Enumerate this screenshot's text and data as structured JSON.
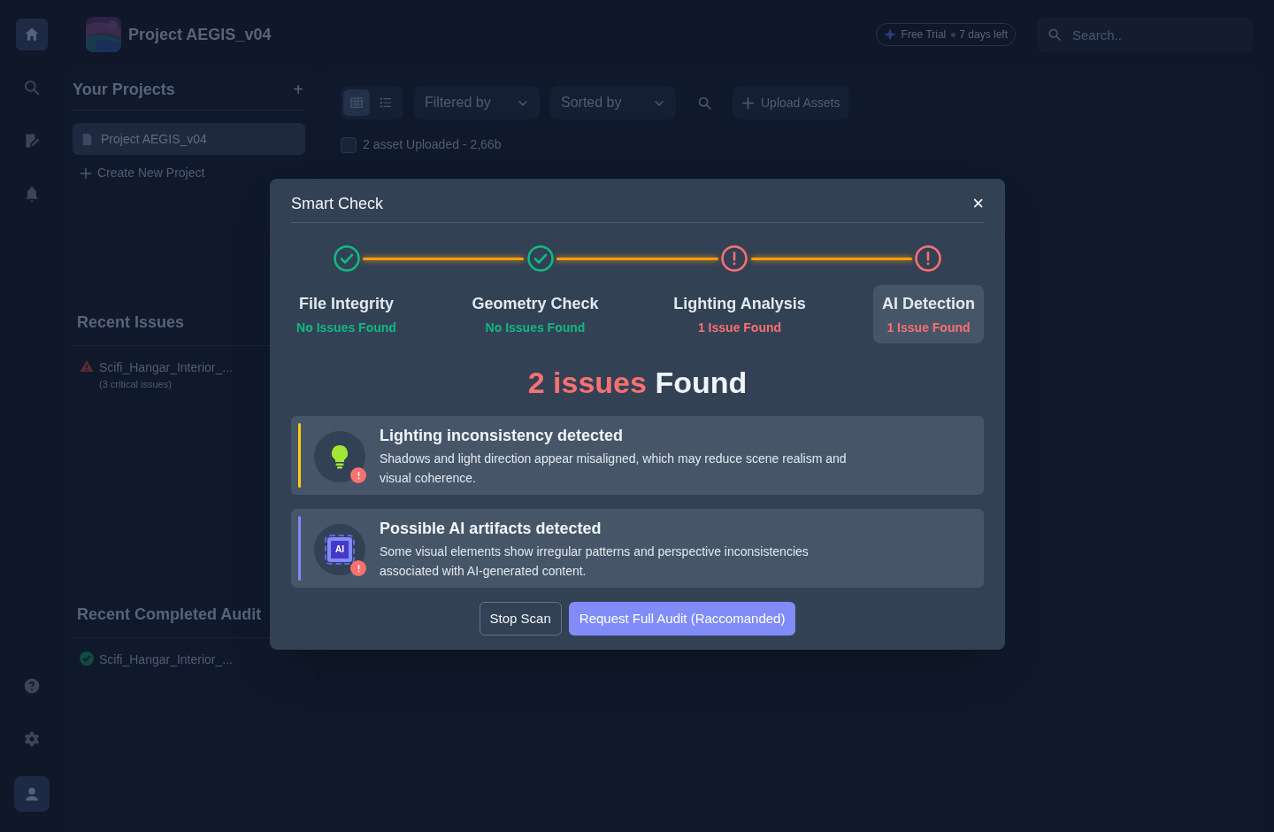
{
  "nav_rail": {
    "top": [
      {
        "kind": "home",
        "selected": true
      },
      {
        "kind": "search",
        "selected": false
      },
      {
        "kind": "report",
        "selected": false
      },
      {
        "kind": "bell",
        "selected": false
      }
    ],
    "bottom": [
      {
        "kind": "help",
        "selected": false
      },
      {
        "kind": "settings",
        "selected": false
      },
      {
        "kind": "user",
        "selected": true
      }
    ]
  },
  "header": {
    "project_title": "Project AEGIS_v04",
    "trial_badge": {
      "label": "Free Trial",
      "days": "7 days left"
    },
    "search": {
      "placeholder": "Search.."
    }
  },
  "projects_panel": {
    "title": "Your Projects",
    "add": "+",
    "items": [
      {
        "label": "Project AEGIS_v04",
        "selected": true
      }
    ],
    "create": "Create New Project"
  },
  "recent_issues": {
    "title": "Recent Issues",
    "items": [
      {
        "kind": "warning",
        "name": "Scifi_Hangar_Interior_...",
        "detail": "(3 critical issues)"
      }
    ]
  },
  "recent_completed": {
    "title": "Recent Completed Audit",
    "items": [
      {
        "kind": "done",
        "name": "Scifi_Hangar_Interior_..."
      }
    ]
  },
  "toolbar": {
    "views": [
      {
        "kind": "grid",
        "selected": true
      },
      {
        "kind": "list",
        "selected": false
      }
    ],
    "filter": "Filtered by",
    "sort": "Sorted by",
    "upload": "Upload Assets"
  },
  "assets": {
    "checked": false,
    "label": "2 asset Uploaded - 2,66b"
  },
  "modal": {
    "title": "Smart Check",
    "close": "×",
    "steps": [
      {
        "label": "File Integrity",
        "result": "No Issues Found",
        "kind": "ok",
        "selected": false
      },
      {
        "label": "Geometry Check",
        "result": "No Issues Found",
        "kind": "ok",
        "selected": false
      },
      {
        "label": "Lighting Analysis",
        "result": "1 Issue Found",
        "kind": "issue",
        "selected": false
      },
      {
        "label": "AI Detection",
        "result": "1 Issue Found",
        "kind": "issue",
        "selected": true
      }
    ],
    "summary": {
      "count": "2 issues",
      "label": "Found"
    },
    "findings": [
      {
        "kind": "lighting",
        "color": "#facc15",
        "title": "Lighting inconsistency detected",
        "text": "Shadows and light direction appear misaligned, which may reduce scene realism and visual coherence."
      },
      {
        "kind": "ai",
        "color": "#818cf8",
        "icon_text": "AI",
        "title": "Possible AI artifacts detected",
        "text": "Some visual elements show irregular patterns and perspective inconsistencies associated with AI-generated content."
      }
    ],
    "buttons": {
      "secondary": "Stop Scan",
      "primary": "Request Full Audit (Raccomanded)"
    }
  }
}
